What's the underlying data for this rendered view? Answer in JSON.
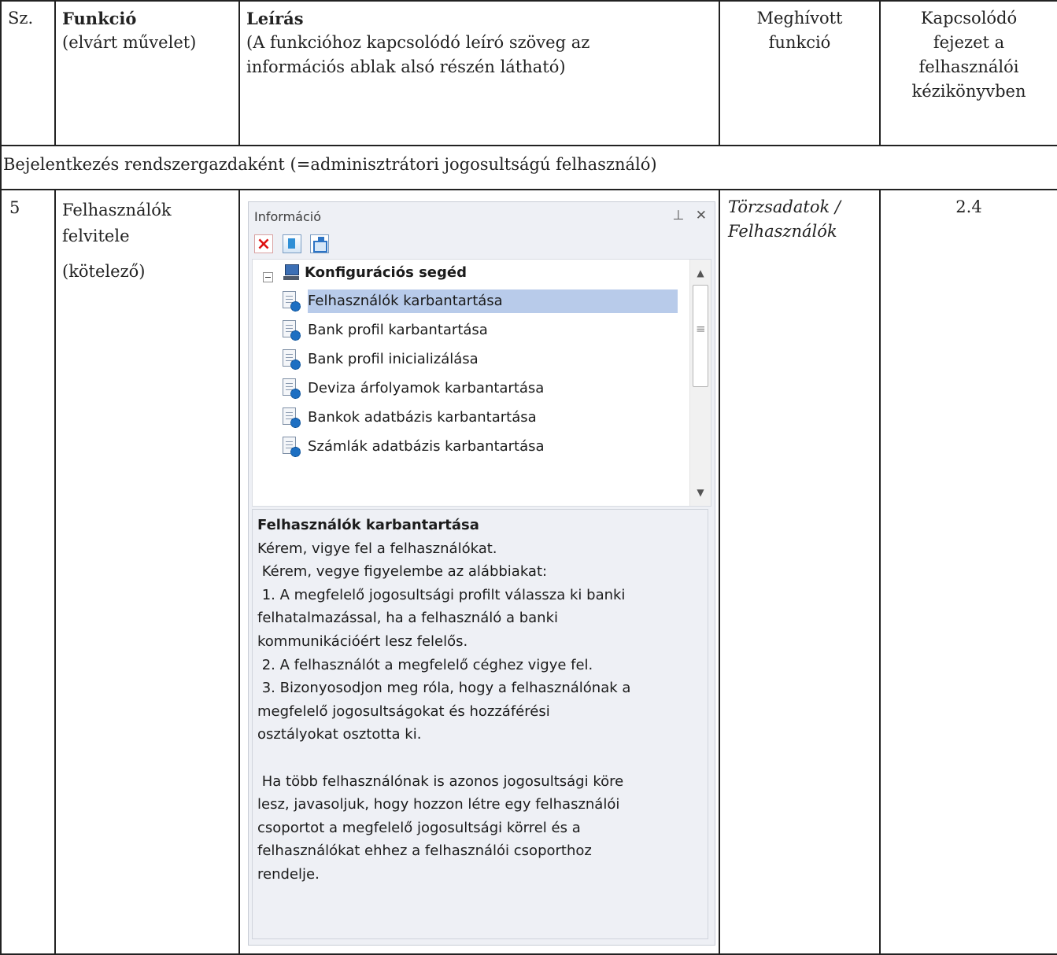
{
  "header": {
    "sz": "Sz.",
    "funkcio_title": "Funkció",
    "funkcio_sub": "(elvárt művelet)",
    "leiras_title": "Leírás",
    "leiras_sub1": "(A funkcióhoz kapcsolódó leíró szöveg az",
    "leiras_sub2": "információs ablak alsó részén látható)",
    "meghivott1": "Meghívott",
    "meghivott2": "funkció",
    "kapcs1": "Kapcsolódó",
    "kapcs2": "fejezet a",
    "kapcs3": "felhasználói",
    "kapcs4": "kézikönyvben"
  },
  "section_title": "Bejelentkezés rendszergazdaként  (=adminisztrátori jogosultságú felhasználó)",
  "row": {
    "number": "5",
    "func1": "Felhasználók",
    "func2": "felvitele",
    "func3": "(kötelező)",
    "called1": "Törzsadatok /",
    "called2": "Felhasználók",
    "chapter": "2.4"
  },
  "panel": {
    "title": "Információ",
    "pin": "⊥",
    "close": "✕",
    "root": "Konfigurációs segéd",
    "items": [
      {
        "label": "Felhasználók karbantartása"
      },
      {
        "label": "Bank profil karbantartása"
      },
      {
        "label": "Bank profil inicializálása"
      },
      {
        "label": "Deviza árfolyamok karbantartása"
      },
      {
        "label": "Bankok adatbázis karbantartása"
      },
      {
        "label": "Számlák adatbázis karbantartása"
      }
    ],
    "selected_index": 0,
    "desc_title": "Felhasználók karbantartása",
    "desc_lines": [
      "Kérem, vigye fel a felhasználókat.",
      " Kérem, vegye figyelembe az alábbiakat:",
      " 1. A megfelelő jogosultsági profilt válassza ki banki",
      "felhatalmazással, ha a felhasználó a banki",
      "kommunikációért lesz felelős.",
      " 2. A felhasználót a megfelelő céghez vigye fel.",
      " 3. Bizonyosodjon meg róla, hogy a felhasználónak a",
      "megfelelő jogosultságokat és hozzáférési",
      "osztályokat osztotta ki.",
      "",
      " Ha több felhasználónak is azonos jogosultsági köre",
      "lesz, javasoljuk, hogy hozzon létre egy felhasználói",
      "csoportot a megfelelő jogosultsági körrel és a",
      "felhasználókat ehhez a felhasználói csoporthoz",
      "rendelje."
    ]
  }
}
